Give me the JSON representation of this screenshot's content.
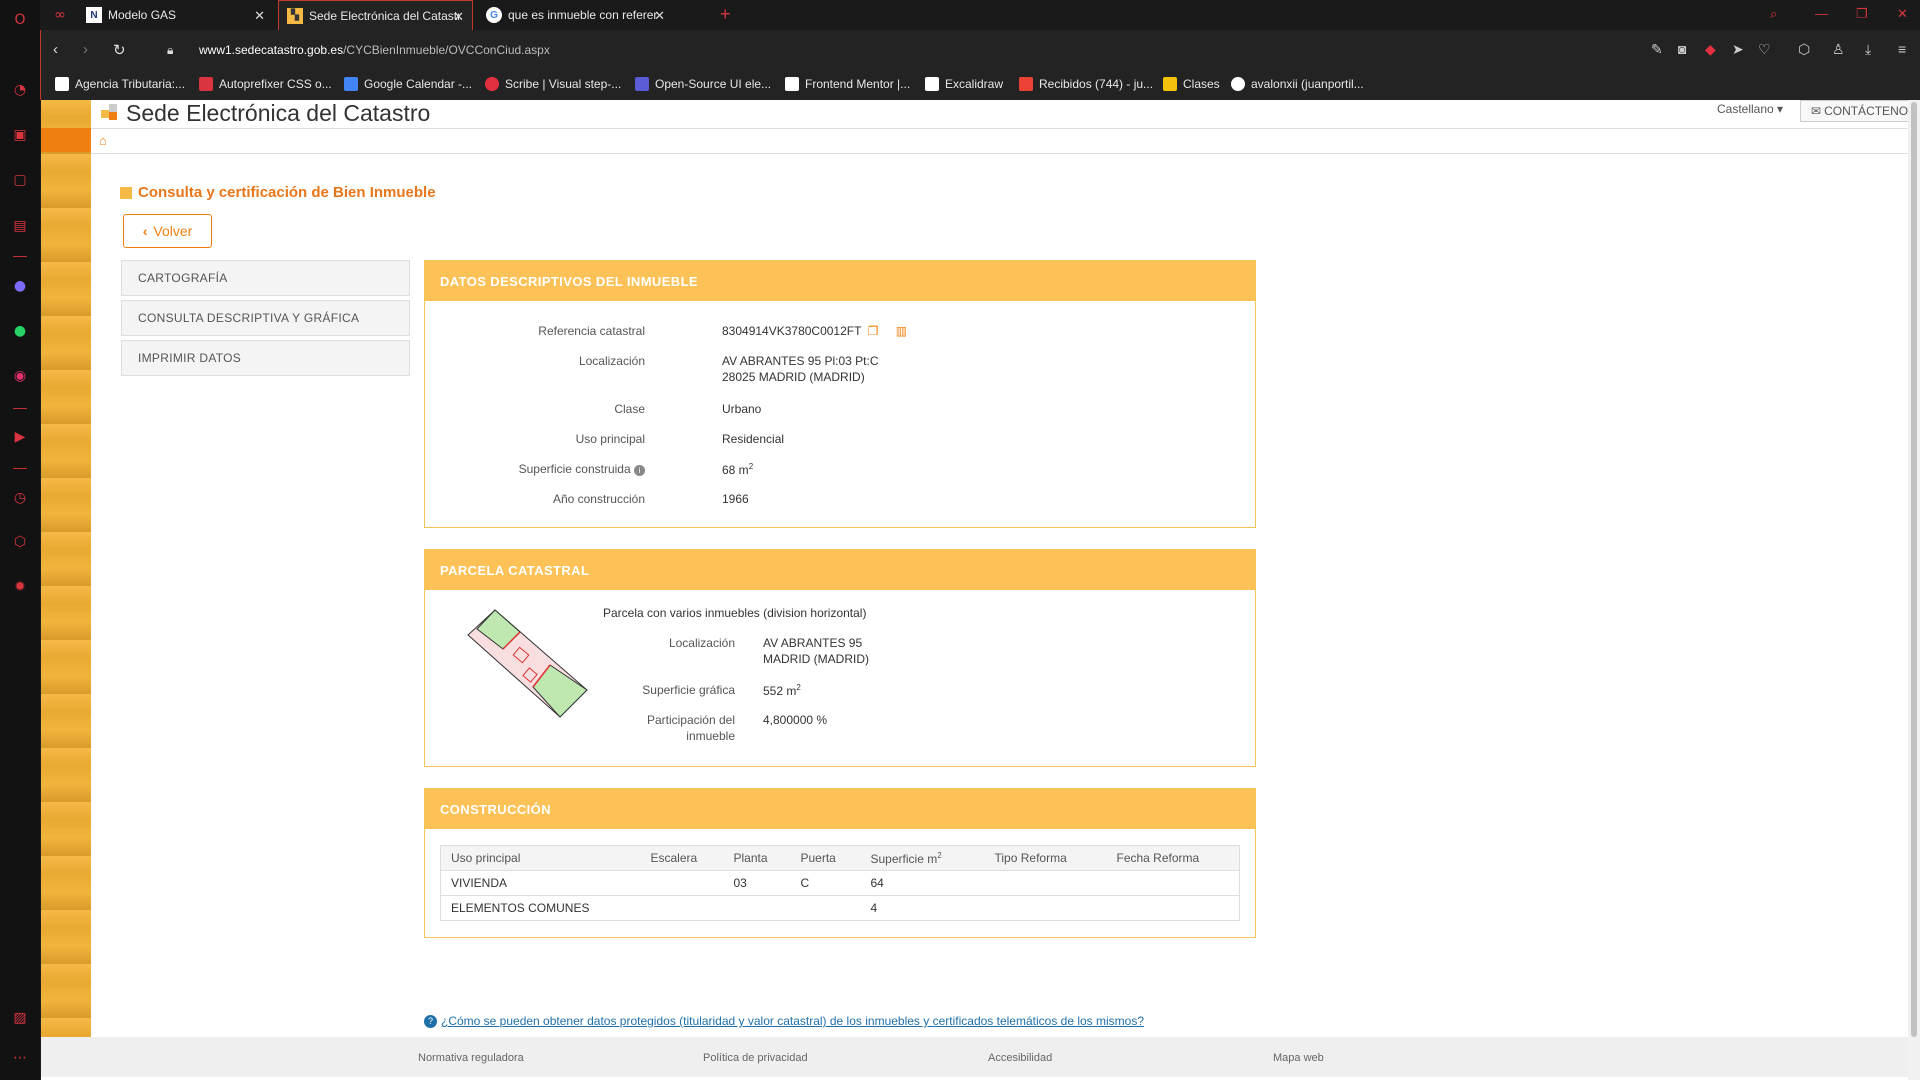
{
  "browser": {
    "tabs": [
      {
        "title": "Modelo GAS"
      },
      {
        "title": "Sede Electrónica del Catastro"
      },
      {
        "title": "que es inmueble con referencia catastral"
      }
    ],
    "url_host": "www1.sedecatastro.gob.es",
    "url_path": "/CYCBienInmueble/OVCConCiud.aspx",
    "bookmarks": [
      "Agencia Tributaria:...",
      "Autoprefixer CSS o...",
      "Google Calendar -...",
      "Scribe | Visual step-...",
      "Open-Source UI ele...",
      "Frontend Mentor |...",
      "Excalidraw",
      "Recibidos (744) - ju...",
      "Clases",
      "avalonxii (juanportil..."
    ]
  },
  "site": {
    "title": "Sede Electrónica del Catastro",
    "language": "Castellano",
    "contact": "CONTÁCTENOS"
  },
  "page": {
    "heading": "Consulta y certificación de Bien Inmueble",
    "back_button": "Volver",
    "menu": [
      "CARTOGRAFÍA",
      "CONSULTA DESCRIPTIVA Y GRÁFICA",
      "IMPRIMIR DATOS"
    ]
  },
  "datos": {
    "title": "DATOS DESCRIPTIVOS DEL INMUEBLE",
    "ref_label": "Referencia catastral",
    "ref_value": "8304914VK3780C0012FT",
    "loc_label": "Localización",
    "loc_line1": "AV ABRANTES 95 Pl:03 Pt:C",
    "loc_line2": "28025 MADRID (MADRID)",
    "clase_label": "Clase",
    "clase_value": "Urbano",
    "uso_label": "Uso principal",
    "uso_value": "Residencial",
    "sup_label": "Superficie construida",
    "sup_value": "68 m",
    "sup_exp": "2",
    "anio_label": "Año construcción",
    "anio_value": "1966"
  },
  "parcela": {
    "title": "PARCELA CATASTRAL",
    "subtitle": "Parcela con varios inmuebles (division horizontal)",
    "loc_label": "Localización",
    "loc_line1": "AV ABRANTES 95",
    "loc_line2": "MADRID (MADRID)",
    "sup_label": "Superficie gráfica",
    "sup_value": "552 m",
    "sup_exp": "2",
    "part_label1": "Participación del",
    "part_label2": "inmueble",
    "part_value": "4,800000 %"
  },
  "construccion": {
    "title": "CONSTRUCCIÓN",
    "headers": [
      "Uso principal",
      "Escalera",
      "Planta",
      "Puerta",
      "Superficie m",
      "Tipo Reforma",
      "Fecha Reforma"
    ],
    "sup_exp": "2",
    "rows": [
      [
        "VIVIENDA",
        "",
        "03",
        "C",
        "64",
        "",
        ""
      ],
      [
        "ELEMENTOS COMUNES",
        "",
        "",
        "",
        "4",
        "",
        ""
      ]
    ]
  },
  "help_link": "¿Cómo se pueden obtener datos protegidos (titularidad y valor catastral) de los inmuebles y certificados telemáticos de los mismos?",
  "footer": [
    "Normativa reguladora",
    "Política de privacidad",
    "Accesibilidad",
    "Mapa web"
  ],
  "colors": {
    "accent": "#f07f12",
    "panel_header": "#fdc257",
    "link": "#1f6fa8"
  }
}
